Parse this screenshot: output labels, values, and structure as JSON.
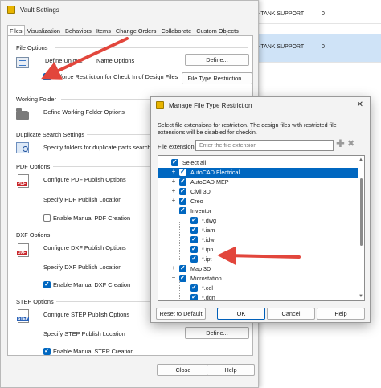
{
  "background_table": {
    "rows": [
      {
        "name": "-TANK SUPPORT",
        "value": "0"
      },
      {
        "name": "-TANK SUPPORT",
        "value": "0"
      }
    ]
  },
  "vault": {
    "title": "Vault Settings",
    "tabs": [
      "Files",
      "Visualization",
      "Behaviors",
      "Items",
      "Change Orders",
      "Collaborate",
      "Custom Objects"
    ],
    "file_options": {
      "section": "File Options",
      "define_unique_label_left": "Define Unique ",
      "define_unique_label_right": "Name Options",
      "define_button": "Define...",
      "enforce_label": "Enforce Restriction for Check In of Design Files",
      "file_type_button": "File Type Restriction..."
    },
    "working_folder": {
      "section": "Working Folder",
      "label": "Define Working Folder Options"
    },
    "duplicate_search": {
      "section": "Duplicate Search Settings",
      "label": "Specify folders for duplicate parts search."
    },
    "pdf": {
      "section": "PDF Options",
      "configure": "Configure PDF Publish Options",
      "location": "Specify PDF Publish Location",
      "enable": "Enable Manual PDF Creation",
      "icon_text": "PDF"
    },
    "dxf": {
      "section": "DXF Options",
      "configure": "Configure DXF Publish Options",
      "location": "Specify DXF Publish Location",
      "enable": "Enable Manual DXF Creation",
      "icon_text": "DXF"
    },
    "step": {
      "section": "STEP Options",
      "configure": "Configure STEP Publish Options",
      "location": "Specify STEP Publish Location",
      "define_button": "Define...",
      "enable": "Enable Manual STEP Creation",
      "icon_text": "STEP"
    },
    "close_button": "Close",
    "help_button": "Help"
  },
  "dialog": {
    "title": "Manage File Type Restriction",
    "description": "Select file extensions for restriction. The design files with restricted file extensions will be disabled for checkin.",
    "extension_label": "File extension:",
    "extension_placeholder": "Enter the file extension",
    "tree": [
      {
        "label": "Select all",
        "level": 0,
        "expander": "",
        "selected": false
      },
      {
        "label": "AutoCAD Electrical",
        "level": 1,
        "expander": "+",
        "selected": true
      },
      {
        "label": "AutoCAD MEP",
        "level": 1,
        "expander": "+",
        "selected": false
      },
      {
        "label": "Civil 3D",
        "level": 1,
        "expander": "+",
        "selected": false
      },
      {
        "label": "Creo",
        "level": 1,
        "expander": "+",
        "selected": false
      },
      {
        "label": "Inventor",
        "level": 1,
        "expander": "−",
        "selected": false
      },
      {
        "label": "*.dwg",
        "level": 2,
        "expander": "",
        "selected": false
      },
      {
        "label": "*.iam",
        "level": 2,
        "expander": "",
        "selected": false
      },
      {
        "label": "*.idw",
        "level": 2,
        "expander": "",
        "selected": false
      },
      {
        "label": "*.ipn",
        "level": 2,
        "expander": "",
        "selected": false
      },
      {
        "label": "*.ipt",
        "level": 2,
        "expander": "",
        "selected": false
      },
      {
        "label": "Map 3D",
        "level": 1,
        "expander": "+",
        "selected": false
      },
      {
        "label": "Microstation",
        "level": 1,
        "expander": "−",
        "selected": false
      },
      {
        "label": "*.cel",
        "level": 2,
        "expander": "",
        "selected": false
      },
      {
        "label": "*.dgn",
        "level": 2,
        "expander": "",
        "selected": false
      }
    ],
    "reset_button": "Reset to Default",
    "ok_button": "OK",
    "cancel_button": "Cancel",
    "help_button": "Help"
  },
  "colors": {
    "accent": "#0067c0",
    "annotation_arrow": "#e2463c"
  }
}
